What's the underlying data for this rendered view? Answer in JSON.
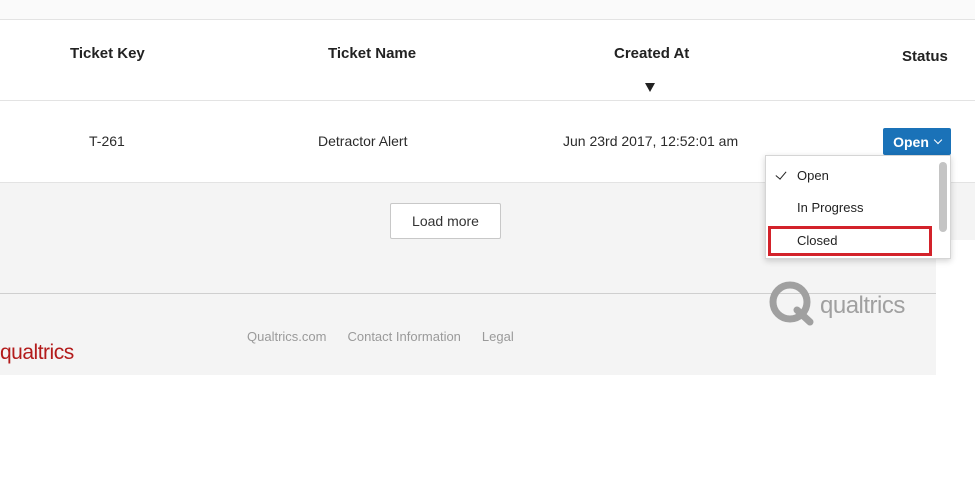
{
  "table": {
    "headers": {
      "ticket_key": "Ticket Key",
      "ticket_name": "Ticket Name",
      "created_at": "Created At",
      "status": "Status"
    },
    "rows": [
      {
        "ticket_key": "T-261",
        "ticket_name": "Detractor Alert",
        "created_at": "Jun 23rd 2017, 12:52:01 am",
        "status": "Open"
      }
    ],
    "sort": {
      "column": "Created At",
      "direction": "descending"
    }
  },
  "status_dropdown": {
    "options": [
      "Open",
      "In Progress",
      "Closed"
    ],
    "selected": "Open",
    "highlighted": "Closed"
  },
  "load_more_label": "Load more",
  "footer": {
    "brand": "qualtrics",
    "links": [
      "Qualtrics.com",
      "Contact Information",
      "Legal"
    ],
    "logo_word": "qualtrics"
  },
  "colors": {
    "primary_button": "#1a72b8",
    "highlight_border": "#d3222a",
    "brand_red": "#b31b1b"
  },
  "icons": [
    "sort-desc-icon",
    "chevron-down-icon",
    "checkmark-icon",
    "qualtrics-logo-icon"
  ]
}
